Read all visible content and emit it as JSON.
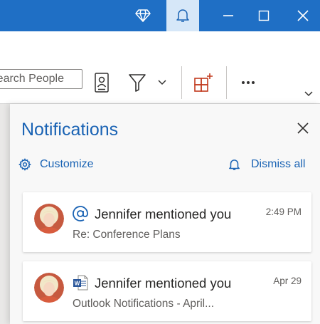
{
  "titlebar": {
    "premium_icon": "diamond-icon",
    "notifications_icon": "bell-icon",
    "minimize_icon": "minimize-icon",
    "maximize_icon": "maximize-icon",
    "close_icon": "close-icon",
    "background_color": "#1f6fc5",
    "active_button_color": "#d6e7f8"
  },
  "ribbon": {
    "search_placeholder": "Search People",
    "address_book_icon": "address-book-icon",
    "filter_icon": "filter-icon",
    "filter_dropdown_icon": "chevron-down-icon",
    "addins_icon": "get-addins-icon",
    "more_icon": "more-icon",
    "expand_icon": "chevron-down-icon"
  },
  "panel": {
    "title": "Notifications",
    "close_icon": "close-icon",
    "customize_label": "Customize",
    "customize_icon": "gear-icon",
    "dismiss_all_label": "Dismiss all",
    "dismiss_all_icon": "bell-icon",
    "accent_color": "#1a63b4"
  },
  "notifications": [
    {
      "title": "Jennifer mentioned you",
      "subtitle": "Re: Conference Plans",
      "time": "2:49 PM",
      "type_icon": "at-mention-icon"
    },
    {
      "title": "Jennifer mentioned you",
      "subtitle": "Outlook Notifications - April...",
      "time": "Apr 29",
      "type_icon": "word-document-icon"
    }
  ]
}
